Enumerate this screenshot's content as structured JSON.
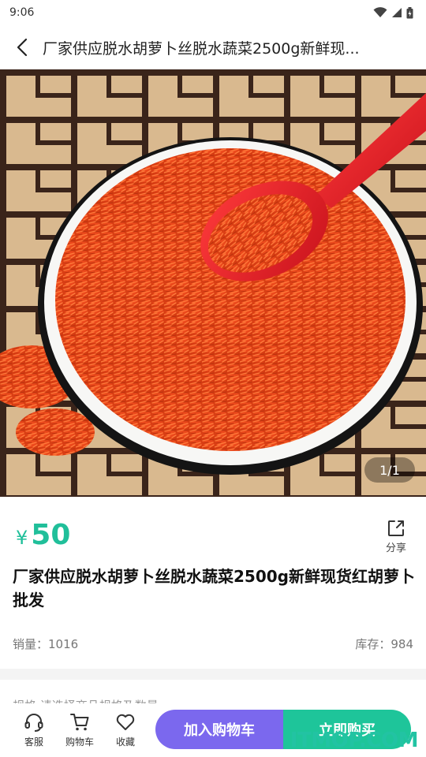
{
  "status_bar": {
    "time": "9:06"
  },
  "header": {
    "title": "厂家供应脱水胡萝卜丝脱水蔬菜2500g新鲜现..."
  },
  "gallery": {
    "page_indicator": "1/1"
  },
  "product": {
    "currency_symbol": "¥",
    "price": "50",
    "share_label": "分享",
    "title": "厂家供应脱水胡萝卜丝脱水蔬菜2500g新鲜现货红胡萝卜批发",
    "sales": "销量：1016",
    "stock": "库存：984"
  },
  "spec": {
    "text": "规格   请选择商品规格及数量"
  },
  "bottom_bar": {
    "service_label": "客服",
    "cart_label": "购物车",
    "favorite_label": "收藏",
    "add_to_cart_label": "加入购物车",
    "buy_now_label": "立即购买"
  },
  "watermark": "ITMOP.COM",
  "colors": {
    "accent": "#20bf9a",
    "cart_button": "#7b68ee",
    "buy_button": "#1ec59a"
  },
  "icons": [
    "wifi-icon",
    "signal-icon",
    "battery-icon",
    "back-arrow-icon",
    "share-icon",
    "headset-icon",
    "cart-icon",
    "heart-icon"
  ]
}
